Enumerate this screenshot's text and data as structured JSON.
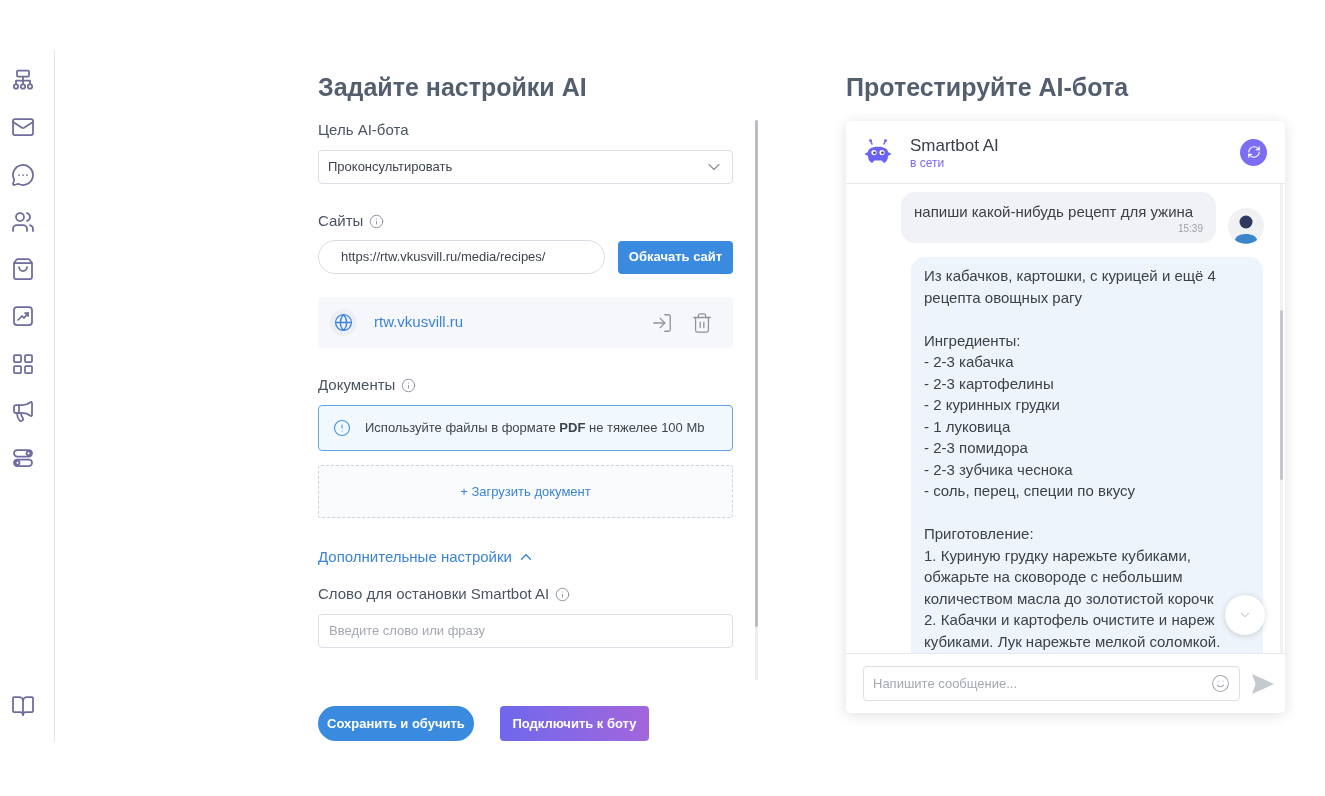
{
  "settings": {
    "title": "Задайте настройки AI",
    "goal": {
      "label": "Цель AI-бота",
      "value": "Проконсультировать"
    },
    "sites": {
      "label": "Сайты",
      "url": "https://rtw.vkusvill.ru/media/recipes/",
      "crawl_button": "Обкачать сайт",
      "items": [
        {
          "domain": "rtw.vkusvill.ru"
        }
      ]
    },
    "documents": {
      "label": "Документы",
      "notice": "Используйте файлы в формате **PDF** не тяжелее 100 Mb",
      "upload": "+ Загрузить документ"
    },
    "advanced": {
      "label": "Дополнительные настройки",
      "expanded": true,
      "stop_word": {
        "label": "Слово для остановки Smartbot AI",
        "placeholder": "Введите слово или фразу"
      }
    },
    "buttons": [
      {
        "label": "Сохранить и обучить",
        "kind": "primary"
      },
      {
        "label": "Подключить к боту",
        "kind": "connect"
      }
    ]
  },
  "chat": {
    "title": "Протестируйте AI-бота",
    "bot": {
      "name": "Smartbot AI",
      "status": "в сети"
    },
    "messages": [
      {
        "kind": "user",
        "text": "напиши какой-нибудь рецепт для ужина",
        "time": "15:39"
      },
      {
        "kind": "bot",
        "paragraphs": [
          "Из кабачков, картошки, с курицей и ещё 4 рецепта овощных рагу",
          "Ингредиенты:\n- 2-3 кабачка\n- 2-3 картофелины\n- 2 куринных грудки\n- 1 луковица\n- 2-3 помидора\n- 2-3 зубчика чеснока\n- соль, перец, специи по вкусу",
          "Приготовление:\n1. Куриную грудку нарежьте кубиками, обжарьте на сковороде с небольшим количеством масла до золотистой корочк\n2. Кабачки и картофель очистите и нареж кубиками. Лук нарежьте мелкой соломкой."
        ]
      }
    ],
    "input": {
      "placeholder": "Напишите сообщение..."
    }
  }
}
